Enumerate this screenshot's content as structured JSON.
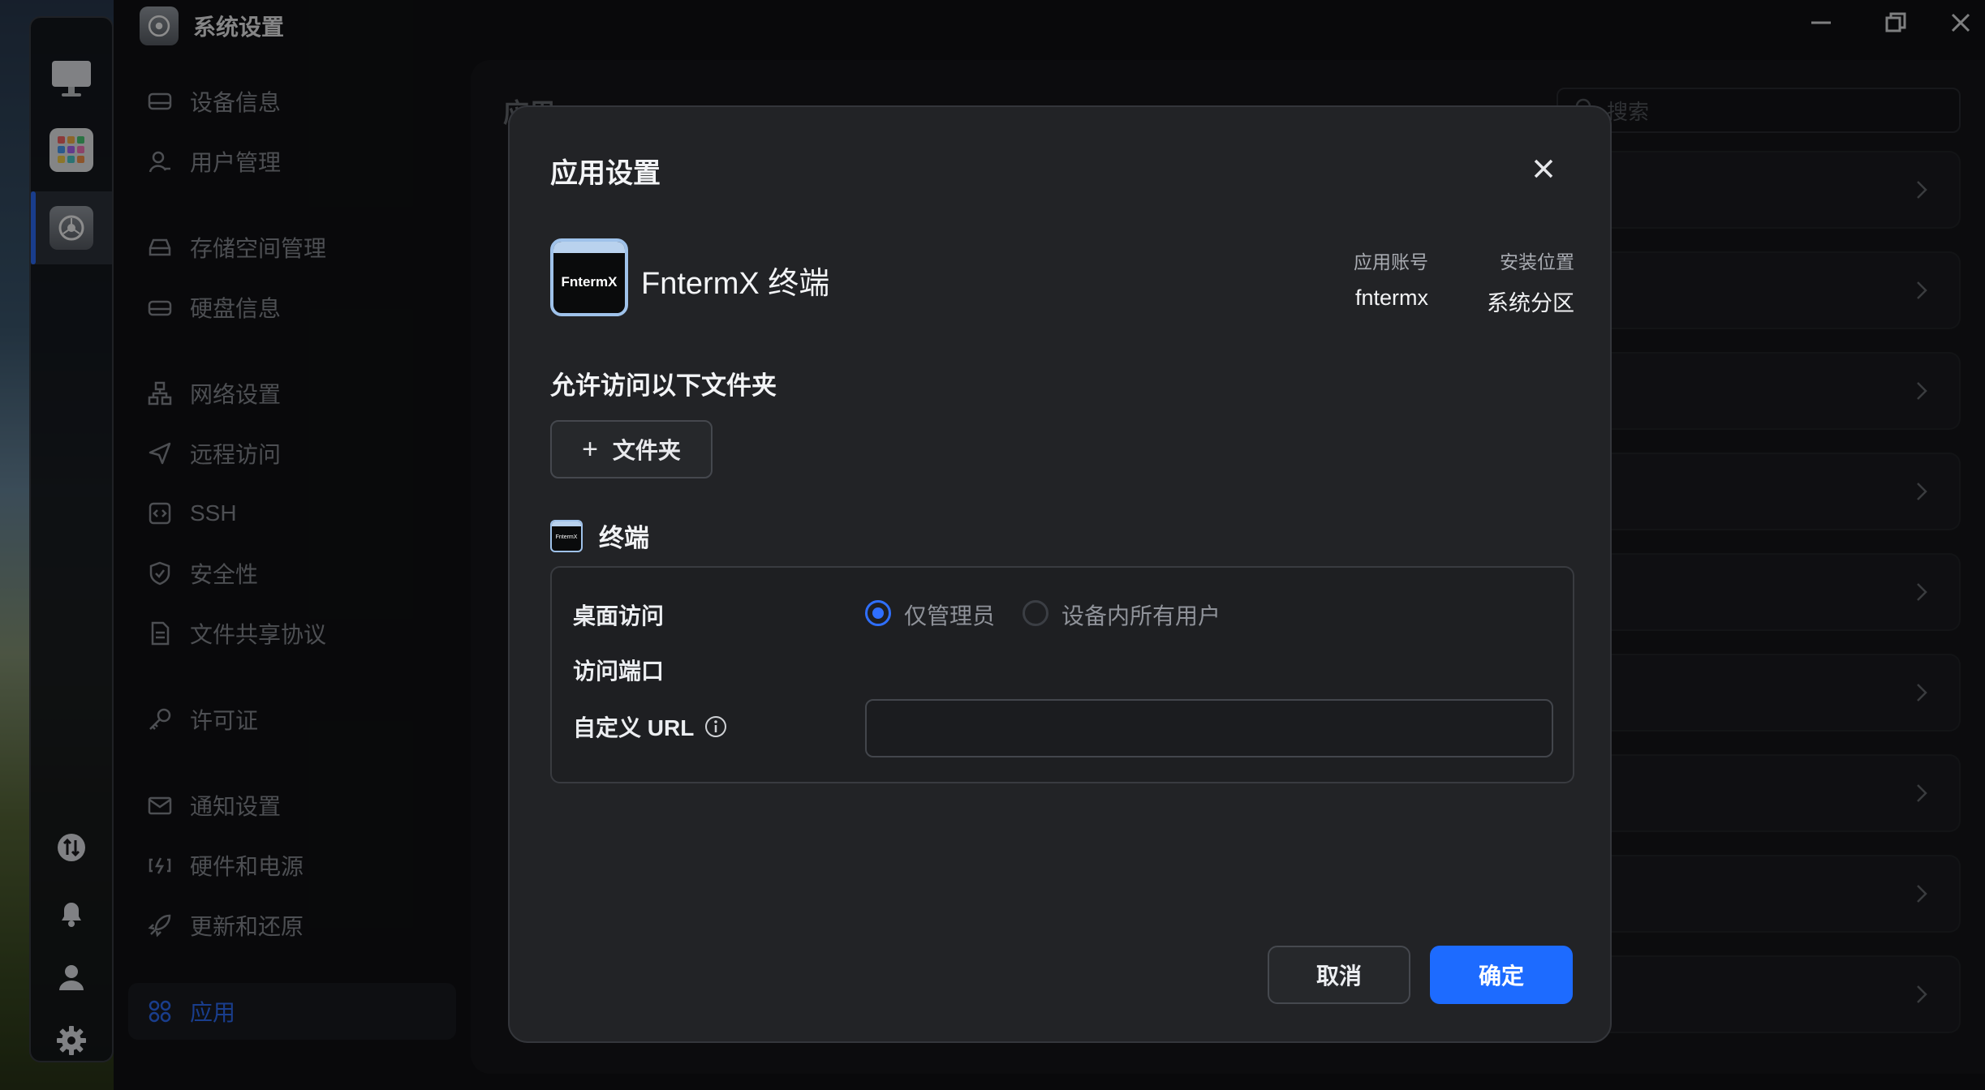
{
  "window": {
    "title": "系统设置"
  },
  "sidebar": {
    "items": [
      {
        "label": "设备信息",
        "icon": "device-icon"
      },
      {
        "label": "用户管理",
        "icon": "user-icon"
      },
      {
        "label": "存储空间管理",
        "icon": "storage-icon"
      },
      {
        "label": "硬盘信息",
        "icon": "disk-icon"
      },
      {
        "label": "网络设置",
        "icon": "network-icon"
      },
      {
        "label": "远程访问",
        "icon": "send-icon"
      },
      {
        "label": "SSH",
        "icon": "code-icon"
      },
      {
        "label": "安全性",
        "icon": "shield-icon"
      },
      {
        "label": "文件共享协议",
        "icon": "file-icon"
      },
      {
        "label": "许可证",
        "icon": "key-icon"
      },
      {
        "label": "通知设置",
        "icon": "mail-icon"
      },
      {
        "label": "硬件和电源",
        "icon": "power-icon"
      },
      {
        "label": "更新和还原",
        "icon": "rocket-icon"
      },
      {
        "label": "应用",
        "icon": "apps-icon",
        "active": true
      }
    ]
  },
  "content": {
    "title": "应用",
    "search_placeholder": "搜索"
  },
  "modal": {
    "title": "应用设置",
    "app": {
      "logo_text": "FntermX",
      "name": "FntermX 终端",
      "account_label": "应用账号",
      "account_value": "fntermx",
      "location_label": "安装位置",
      "location_value": "系统分区"
    },
    "folders_title": "允许访问以下文件夹",
    "add_folder_label": "文件夹",
    "section_title": "终端",
    "section_logo_text": "FntermX",
    "desktop_access_label": "桌面访问",
    "radio_admin_label": "仅管理员",
    "radio_all_label": "设备内所有用户",
    "port_label": "访问端口",
    "custom_url_label": "自定义 URL",
    "custom_url_value": "",
    "cancel_label": "取消",
    "ok_label": "确定"
  },
  "colors": {
    "accent": "#2f6fff",
    "primary_button": "#1d6bff",
    "modal_bg": "#222326"
  }
}
